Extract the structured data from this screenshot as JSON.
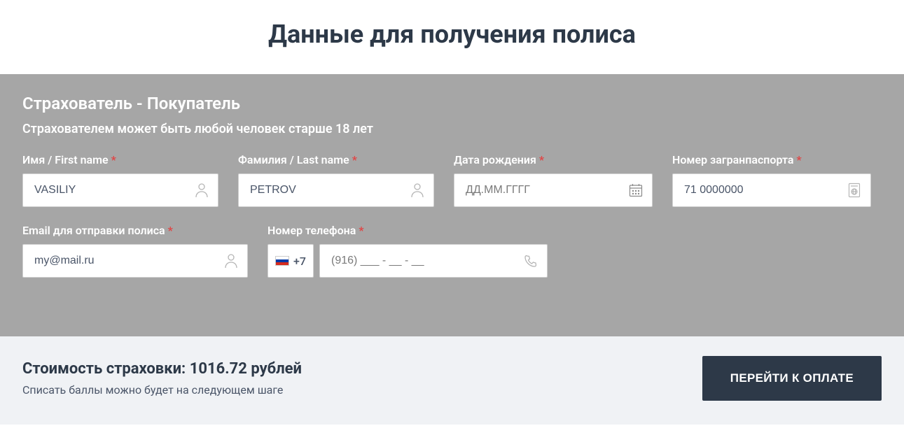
{
  "page_title": "Данные для получения полиса",
  "section": {
    "title": "Страхователь - Покупатель",
    "subtitle": "Страхователем может быть любой человек старше 18 лет"
  },
  "fields": {
    "first_name": {
      "label": "Имя / First name",
      "value": "VASILIY"
    },
    "last_name": {
      "label": "Фамилия / Last name",
      "value": "PETROV"
    },
    "birth_date": {
      "label": "Дата рождения",
      "placeholder": "ДД.ММ.ГГГГ"
    },
    "passport": {
      "label": "Номер загранпаспорта",
      "value": "71 0000000"
    },
    "email": {
      "label": "Email для отправки полиса",
      "value": "my@mail.ru"
    },
    "phone": {
      "label": "Номер телефона",
      "prefix": "+7",
      "placeholder": "(916) ___ - __ - __"
    }
  },
  "footer": {
    "cost_label": "Стоимость страховки:",
    "cost_value": "1016.72",
    "cost_currency": "рублей",
    "note": "Списать баллы можно будет на следующем шаге",
    "button": "ПЕРЕЙТИ К ОПЛАТЕ"
  }
}
